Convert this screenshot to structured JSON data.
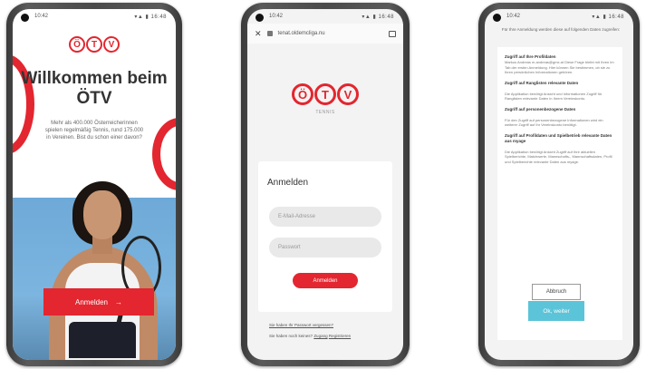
{
  "status": {
    "time": "10:42",
    "icons": "▾▲ ▮ 16:48"
  },
  "brand": {
    "logo_letters": [
      "Ö",
      "T",
      "V"
    ],
    "sub": "TENNIS",
    "color": "#e3262f"
  },
  "screen1": {
    "title": "Willkommen beim ÖTV",
    "intro": "Mehr als 400.000 Österreicherinnen spielen regelmäßig Tennis, rund 175.000 in Vereinen. Bist du schon einer davon?",
    "cta": "Anmelden",
    "cta_arrow": "→"
  },
  "screen2": {
    "url": "tenat.oldemcliga.nu",
    "card_title": "Anmelden",
    "email_placeholder": "E-Mail-Adresse",
    "password_placeholder": "Passwort",
    "cta": "Anmelden",
    "forgot": "Sie haben Ihr Passwort vergessen?",
    "register_prefix": "Sie haben noch keines?",
    "register_link_1": "Zugang",
    "register_link_2": "Registrieren"
  },
  "screen3": {
    "header": "Für Ihre Anmeldung werden diese auf folgenden Daten zugreifen:",
    "blocks": [
      {
        "h": "Zugriff auf Ihre Profildaten",
        "t": "Markus Andreas m.andreas@gmx.at Diese Frage bleibt mit Ihren im Tab der ersten Anmeldung. Hier können Sie bestimmen, ob sie zu Ihren persönlichen Informationen gehören."
      },
      {
        "h": "Zugriff auf Ranglisten relevante Daten",
        "t": ""
      },
      {
        "h": "",
        "t": "Die Applikation benötigt Ansicht und Informationen Zugriff für Ranglisten relevante Daten in Ihrem Vereinskonto."
      },
      {
        "h": "Zugriff auf personenbezogene Daten",
        "t": ""
      },
      {
        "h": "",
        "t": "Für den Zugriff auf personenbezogene Informationen wird ein weiterer Zugriff auf Ihr Vereinskonto benötigt."
      },
      {
        "h": "Zugriff auf Profildaten und Spielbetrieb relevante Daten aus myage",
        "t": ""
      },
      {
        "h": "",
        "t": "Die Applikation benötigt Ansicht Zugriff auf Ihre aktuellen Spielberichte, Matchwerte, Mannschafts-, Mannschaftsdaten, Profil und Spielberichte relevante Daten aus myage."
      }
    ],
    "cancel": "Abbruch",
    "ok": "Ok, weiter"
  }
}
